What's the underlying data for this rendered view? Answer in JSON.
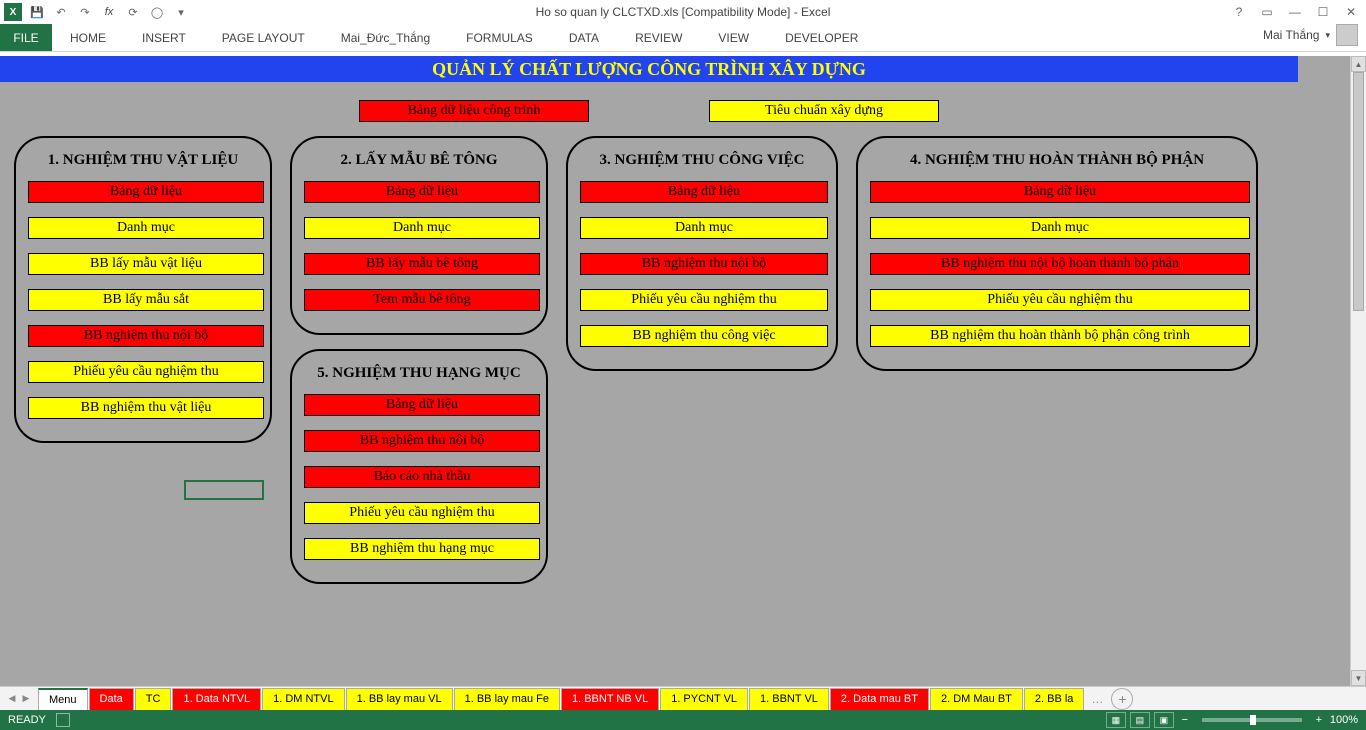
{
  "title": "Ho so quan ly CLCTXD.xls  [Compatibility Mode] - Excel",
  "user": "Mai Thắng",
  "ribbon": [
    "HOME",
    "INSERT",
    "PAGE LAYOUT",
    "Mai_Đức_Thắng",
    "FORMULAS",
    "DATA",
    "REVIEW",
    "VIEW",
    "DEVELOPER"
  ],
  "file_tab": "FILE",
  "banner": "QUẢN LÝ CHẤT LƯỢNG CÔNG TRÌNH XÂY DỰNG",
  "top_buttons": [
    {
      "label": "Bảng dữ liệu công trình",
      "color": "red"
    },
    {
      "label": "Tiêu chuẩn xây dựng",
      "color": "yellow"
    }
  ],
  "panels": {
    "p1": {
      "title": "1. NGHIỆM THU VẬT LIỆU",
      "items": [
        {
          "label": "Bảng dữ liệu",
          "color": "red"
        },
        {
          "label": "Danh mục",
          "color": "yellow"
        },
        {
          "label": "BB lấy mẫu vật liệu",
          "color": "yellow"
        },
        {
          "label": "BB lấy mẫu sắt",
          "color": "yellow"
        },
        {
          "label": "BB nghiệm thu nội bộ",
          "color": "red"
        },
        {
          "label": "Phiếu yêu cầu nghiệm thu",
          "color": "yellow"
        },
        {
          "label": "BB nghiệm thu vật liệu",
          "color": "yellow"
        }
      ]
    },
    "p2a": {
      "title": "2. LẤY MẪU BÊ TÔNG",
      "items": [
        {
          "label": "Bảng dữ liệu",
          "color": "red"
        },
        {
          "label": "Danh mục",
          "color": "yellow"
        },
        {
          "label": "BB lấy mẫu bê tông",
          "color": "red"
        },
        {
          "label": "Tem mẫu bê tông",
          "color": "red"
        }
      ]
    },
    "p2b": {
      "title": "5. NGHIỆM THU HẠNG MỤC",
      "items": [
        {
          "label": "Bảng dữ liệu",
          "color": "red"
        },
        {
          "label": "BB nghiệm thu nội bộ",
          "color": "red"
        },
        {
          "label": "Báo cáo nhà thầu",
          "color": "red"
        },
        {
          "label": "Phiếu yêu cầu nghiệm thu",
          "color": "yellow"
        },
        {
          "label": "BB nghiệm thu hạng mục",
          "color": "yellow"
        }
      ]
    },
    "p3": {
      "title": "3. NGHIỆM THU CÔNG VIỆC",
      "items": [
        {
          "label": "Bảng dữ liệu",
          "color": "red"
        },
        {
          "label": "Danh mục",
          "color": "yellow"
        },
        {
          "label": "BB nghiệm thu nội bộ",
          "color": "red"
        },
        {
          "label": "Phiếu yêu cầu nghiệm thu",
          "color": "yellow"
        },
        {
          "label": "BB nghiệm thu công việc",
          "color": "yellow"
        }
      ]
    },
    "p4": {
      "title": "4. NGHIỆM THU HOÀN THÀNH BỘ PHẬN",
      "items": [
        {
          "label": "Bảng dữ liệu",
          "color": "red"
        },
        {
          "label": "Danh mục",
          "color": "yellow"
        },
        {
          "label": "BB nghiệm thu nội bộ hoàn thành bộ phận",
          "color": "red"
        },
        {
          "label": "Phiếu yêu cầu nghiệm thu",
          "color": "yellow"
        },
        {
          "label": "BB nghiệm thu hoàn thành bộ phận công trình",
          "color": "yellow"
        }
      ]
    }
  },
  "sheet_tabs": [
    {
      "label": "Menu",
      "cls": "active"
    },
    {
      "label": "Data",
      "cls": "t-red"
    },
    {
      "label": "TC",
      "cls": "t-yellow"
    },
    {
      "label": "1. Data NTVL",
      "cls": "t-red"
    },
    {
      "label": "1. DM NTVL",
      "cls": "t-yellow"
    },
    {
      "label": "1. BB lay mau VL",
      "cls": "t-yellow"
    },
    {
      "label": "1. BB lay mau Fe",
      "cls": "t-yellow"
    },
    {
      "label": "1. BBNT NB VL",
      "cls": "t-red"
    },
    {
      "label": "1. PYCNT VL",
      "cls": "t-yellow"
    },
    {
      "label": "1. BBNT VL",
      "cls": "t-yellow"
    },
    {
      "label": "2. Data mau BT",
      "cls": "t-red"
    },
    {
      "label": "2. DM Mau BT",
      "cls": "t-yellow"
    },
    {
      "label": "2. BB la",
      "cls": "t-yellow"
    }
  ],
  "status": {
    "ready": "READY",
    "zoom": "100%"
  }
}
